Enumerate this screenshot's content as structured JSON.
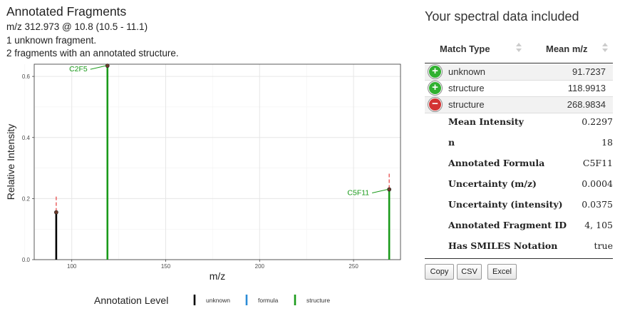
{
  "header": {
    "title": "Annotated Fragments",
    "line1": "m/z 312.973 @ 10.8 (10.5 - 11.1)",
    "line2": "1 unknown fragment.",
    "line3": "2 fragments with an annotated structure."
  },
  "chart_data": {
    "type": "bar",
    "xlabel": "m/z",
    "ylabel": "Relative Intensity",
    "xlim": [
      80,
      275
    ],
    "ylim": [
      0,
      0.64
    ],
    "x_ticks": [
      100,
      150,
      200,
      250
    ],
    "y_ticks": [
      0.0,
      0.2,
      0.4,
      0.6
    ],
    "y_tick_labels": [
      "0.0",
      "0.2",
      "0.4",
      "0.6"
    ],
    "grid": true,
    "legend_title": "Annotation Level",
    "legend_position": "bottom",
    "legend": [
      {
        "label": "unknown",
        "color": "#000000"
      },
      {
        "label": "formula",
        "color": "#2b8cd6"
      },
      {
        "label": "structure",
        "color": "#1a9a1a"
      }
    ],
    "peaks": [
      {
        "mz": 91.7237,
        "intensity": 0.155,
        "level": "unknown",
        "annotation": ""
      },
      {
        "mz": 118.9913,
        "intensity": 0.635,
        "level": "structure",
        "annotation": "C2F5"
      },
      {
        "mz": 268.9834,
        "intensity": 0.23,
        "level": "structure",
        "annotation": "C5F11"
      }
    ]
  },
  "right": {
    "title": "Your spectral data included",
    "col_match_type": "Match Type",
    "col_mean_mz": "Mean m/z",
    "rows": [
      {
        "type": "unknown",
        "mz": "91.7237",
        "icon": "plus"
      },
      {
        "type": "structure",
        "mz": "118.9913",
        "icon": "plus"
      },
      {
        "type": "structure",
        "mz": "268.9834",
        "icon": "minus"
      }
    ],
    "details": [
      {
        "label": "Mean Intensity",
        "value": "0.2297"
      },
      {
        "label": "n",
        "value": "18"
      },
      {
        "label": "Annotated Formula",
        "value": "C5F11"
      },
      {
        "label": "Uncertainty (m/z)",
        "value": "0.0004"
      },
      {
        "label": "Uncertainty (intensity)",
        "value": "0.0375"
      },
      {
        "label": "Annotated Fragment ID",
        "value": "4, 105"
      },
      {
        "label": "Has SMILES Notation",
        "value": "true"
      }
    ],
    "buttons": {
      "copy": "Copy",
      "csv": "CSV",
      "excel": "Excel"
    }
  }
}
